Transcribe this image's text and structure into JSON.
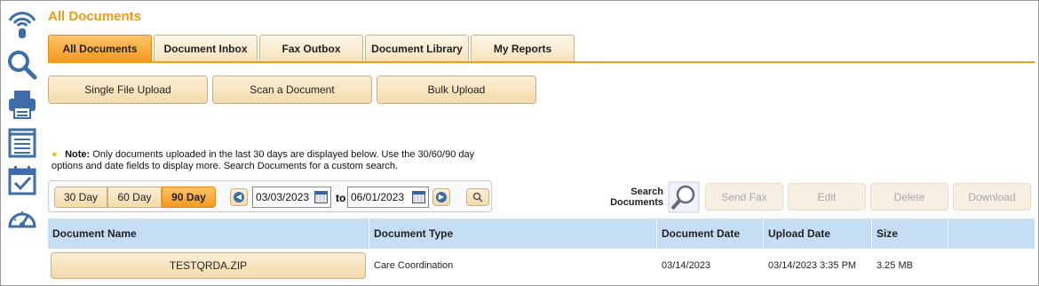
{
  "page": {
    "title": "All Documents"
  },
  "sidebar": [
    {
      "name": "signal-icon"
    },
    {
      "name": "search-icon"
    },
    {
      "name": "fax-icon"
    },
    {
      "name": "list-icon"
    },
    {
      "name": "calendar-check-icon"
    },
    {
      "name": "dashboard-gauge-icon"
    }
  ],
  "tabs": [
    {
      "label": "All Documents",
      "active": true
    },
    {
      "label": "Document Inbox"
    },
    {
      "label": "Fax Outbox"
    },
    {
      "label": "Document Library"
    },
    {
      "label": "My Reports"
    }
  ],
  "actions": {
    "single_upload": "Single File Upload",
    "scan": "Scan a Document",
    "bulk": "Bulk Upload"
  },
  "note": {
    "label": "Note:",
    "text": "Only documents uploaded in the last 30 days are displayed below. Use the 30/60/90 day options and date fields to display more. Search Documents for a custom search."
  },
  "range": {
    "d30": "30 Day",
    "d60": "60 Day",
    "d90": "90 Day",
    "active": "90 Day",
    "from": "03/03/2023",
    "to_label": "to",
    "to": "06/01/2023"
  },
  "search_label_1": "Search",
  "search_label_2": "Documents",
  "toolbar": {
    "send_fax": "Send Fax",
    "edit": "Edit",
    "delete": "Delete",
    "download": "Download"
  },
  "table": {
    "headers": [
      "Document Name",
      "Document Type",
      "Document Date",
      "Upload Date",
      "Size"
    ],
    "rows": [
      [
        "TESTQRDA.ZIP",
        "Care Coordination",
        "03/14/2023",
        "03/14/2023 3:35 PM",
        "3.25 MB"
      ]
    ]
  },
  "colors": {
    "accent": "#f29a1b",
    "header_bg": "#c5def4"
  }
}
